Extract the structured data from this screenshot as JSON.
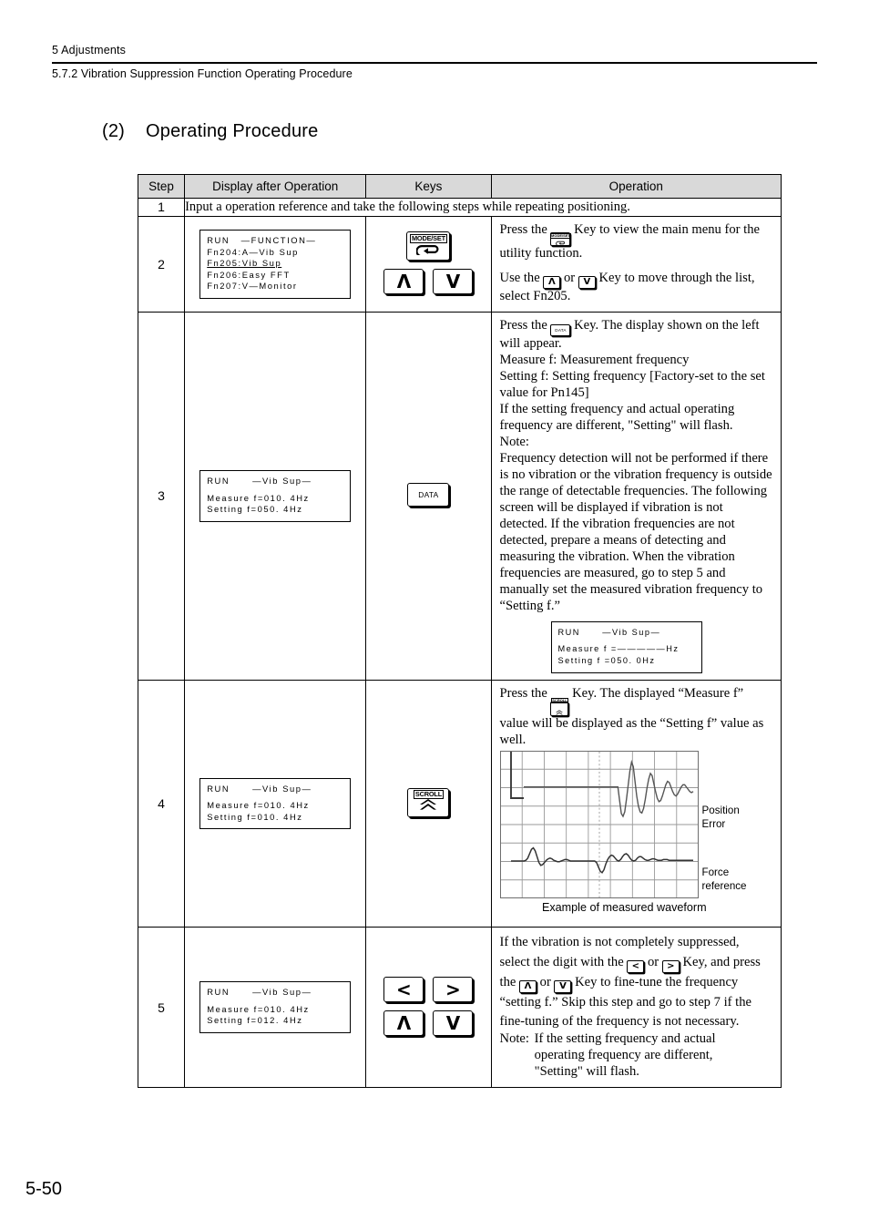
{
  "header": {
    "chapter": "5  Adjustments",
    "section": "5.7.2  Vibration Suppression Function Operating Procedure"
  },
  "title": {
    "number": "(2)",
    "text": "Operating Procedure"
  },
  "table": {
    "columns": [
      "Step",
      "Display after Operation",
      "Keys",
      "Operation"
    ],
    "rows": [
      {
        "step": "1",
        "full_text": "Input a operation reference and take the following steps while repeating positioning."
      },
      {
        "step": "2",
        "display": {
          "line1_left": "RUN",
          "line1_right": "—FUNCTION—",
          "line2": "Fn204:A—Vib Sup",
          "line3": "Fn205:Vib Sup",
          "line4": "Fn206:Easy FFT",
          "line5": "Fn207:V—Monitor"
        },
        "keys": [
          {
            "name": "mode-set-key",
            "label": "MODE/SET",
            "glyph": "loop-arrow"
          },
          {
            "name": "up-key",
            "label": "",
            "glyph": "up-arrow"
          },
          {
            "name": "down-key",
            "label": "",
            "glyph": "down-arrow"
          }
        ],
        "operation": {
          "p1_a": "Press the ",
          "p1_b": " Key to view the main menu for the utility function.",
          "p2_a": "Use the ",
          "p2_b": " or ",
          "p2_c": " Key to move through the list, select Fn205."
        }
      },
      {
        "step": "3",
        "display": {
          "line1_left": "RUN",
          "line1_right": "—Vib Sup—",
          "line3": "Measure f=010. 4Hz",
          "line4": "Setting f=050. 4Hz"
        },
        "keys": [
          {
            "name": "data-key",
            "label": "DATA",
            "glyph": ""
          }
        ],
        "operation": {
          "p1_a": "Press the ",
          "p1_b": " Key. The display shown on the left will appear.",
          "p2": "Measure f: Measurement frequency",
          "p3": "Setting f: Setting frequency [Factory-set to the set value for Pn145]",
          "p4": "If the setting frequency and actual operating frequency are different, \"Setting\" will flash.",
          "p5": "Note:",
          "p6": "Frequency detection will not be performed if there is no vibration or the vibration frequency is outside the range of detectable frequencies. The following screen will be displayed if vibration is not detected. If the vibration frequencies are not detected, prepare a means of detecting and measuring the vibration. When the vibration frequencies are measured, go to step 5 and manually set the measured vibration frequency to “Setting f.”"
        },
        "inline_display": {
          "line1_left": "RUN",
          "line1_right": "—Vib Sup—",
          "line3": "Measure f =—————Hz",
          "line4": "Setting f =050. 0Hz"
        }
      },
      {
        "step": "4",
        "display": {
          "line1_left": "RUN",
          "line1_right": "—Vib Sup—",
          "line3": "Measure f=010. 4Hz",
          "line4": "Setting f=010. 4Hz"
        },
        "keys": [
          {
            "name": "scroll-key",
            "label": "SCROLL",
            "glyph": "double-chevron-up"
          }
        ],
        "operation": {
          "p1_a": "Press the ",
          "p1_b": " Key. The displayed “Measure f” value will be displayed as the “Setting f” value as well."
        },
        "figure": {
          "label_position_error": "Position\nError",
          "label_force_reference": "Force\nreference",
          "caption": "Example of measured waveform"
        }
      },
      {
        "step": "5",
        "display": {
          "line1_left": "RUN",
          "line1_right": "—Vib Sup—",
          "line3": "Measure f=010. 4Hz",
          "line4": "Setting f=012. 4Hz"
        },
        "keys": [
          {
            "name": "left-key",
            "label": "",
            "glyph": "left-arrow"
          },
          {
            "name": "right-key",
            "label": "",
            "glyph": "right-arrow"
          },
          {
            "name": "up-key",
            "label": "",
            "glyph": "up-arrow"
          },
          {
            "name": "down-key",
            "label": "",
            "glyph": "down-arrow"
          }
        ],
        "operation": {
          "p1_a": "If the vibration is not completely suppressed, select the digit with the ",
          "p1_b": " or ",
          "p1_c": " Key, and press the ",
          "p1_d": " or ",
          "p1_e": " Key to fine-tune the frequency “setting f.” Skip this step and go to step 7 if the fine-tuning of the frequency is not necessary.",
          "p2_label": "Note:",
          "p2_text": "If the setting frequency and actual operating frequency are different, \"Setting\" will flash."
        }
      }
    ]
  },
  "footer": {
    "page": "5-50"
  },
  "chart_data": {
    "type": "line",
    "title": "Example of measured waveform",
    "xlabel": "",
    "ylabel": "",
    "grid": true,
    "legend_position": "right",
    "xlim": [
      0,
      100
    ],
    "series": [
      {
        "name": "Position Error",
        "values": [
          52,
          52,
          52,
          52,
          52,
          52,
          52,
          52,
          52,
          52,
          52,
          52,
          52,
          52,
          52,
          52,
          52,
          52,
          52,
          52,
          52,
          52,
          52,
          52,
          52,
          52,
          52,
          52,
          52,
          52,
          52,
          52,
          52,
          52,
          52,
          52,
          52,
          52,
          52,
          52,
          52,
          52,
          52,
          52,
          52,
          52,
          52,
          52,
          52,
          52,
          52,
          52,
          52,
          52,
          52,
          52,
          28,
          5,
          0,
          8,
          30,
          55,
          80,
          96,
          88,
          62,
          36,
          18,
          8,
          6,
          14,
          30,
          50,
          66,
          76,
          72,
          58,
          44,
          32,
          26,
          28,
          36,
          46,
          56,
          62,
          60,
          52,
          44,
          38,
          36,
          40,
          46,
          52,
          56,
          56,
          52,
          48,
          44,
          42,
          44
        ]
      },
      {
        "name": "Force reference",
        "values": [
          0,
          0,
          0,
          0,
          0,
          0,
          0,
          0,
          1,
          4,
          10,
          16,
          18,
          14,
          6,
          -2,
          -6,
          -5,
          -2,
          1,
          3,
          4,
          3,
          1,
          0,
          -1,
          -1,
          0,
          1,
          2,
          2,
          1,
          0,
          0,
          0,
          0,
          0,
          0,
          0,
          0,
          0,
          0,
          0,
          0,
          0,
          0,
          -2,
          -8,
          -14,
          -16,
          -12,
          -4,
          2,
          6,
          8,
          7,
          4,
          1,
          0,
          2,
          6,
          9,
          10,
          8,
          4,
          1,
          0,
          1,
          4,
          6,
          6,
          4,
          2,
          1,
          1,
          2,
          3,
          3,
          2,
          1,
          1,
          1,
          2,
          2,
          2,
          1,
          1,
          1,
          1,
          1,
          1,
          1,
          1,
          1,
          1,
          1,
          1,
          1,
          1
        ]
      }
    ]
  }
}
